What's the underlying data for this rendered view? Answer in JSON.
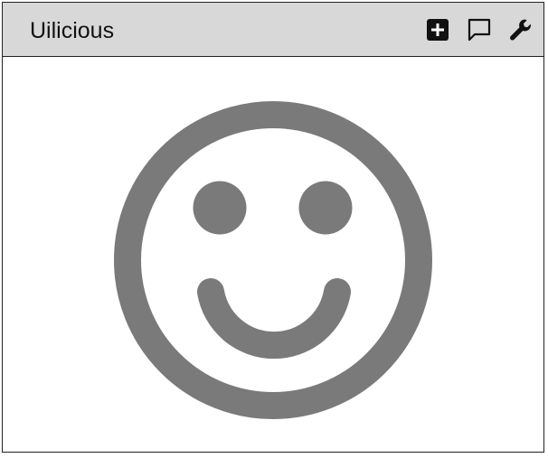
{
  "window": {
    "title": "Uilicious"
  },
  "toolbar": {
    "items": [
      {
        "icon": "add-square-icon"
      },
      {
        "icon": "comment-icon"
      },
      {
        "icon": "wrench-icon"
      }
    ]
  },
  "main": {
    "image": {
      "icon": "smiley-face-icon",
      "color": "#7a7a7a"
    }
  },
  "colors": {
    "titlebar_bg": "#d8d8d8",
    "border": "#222222",
    "icon": "#111111",
    "smiley": "#7a7a7a"
  }
}
